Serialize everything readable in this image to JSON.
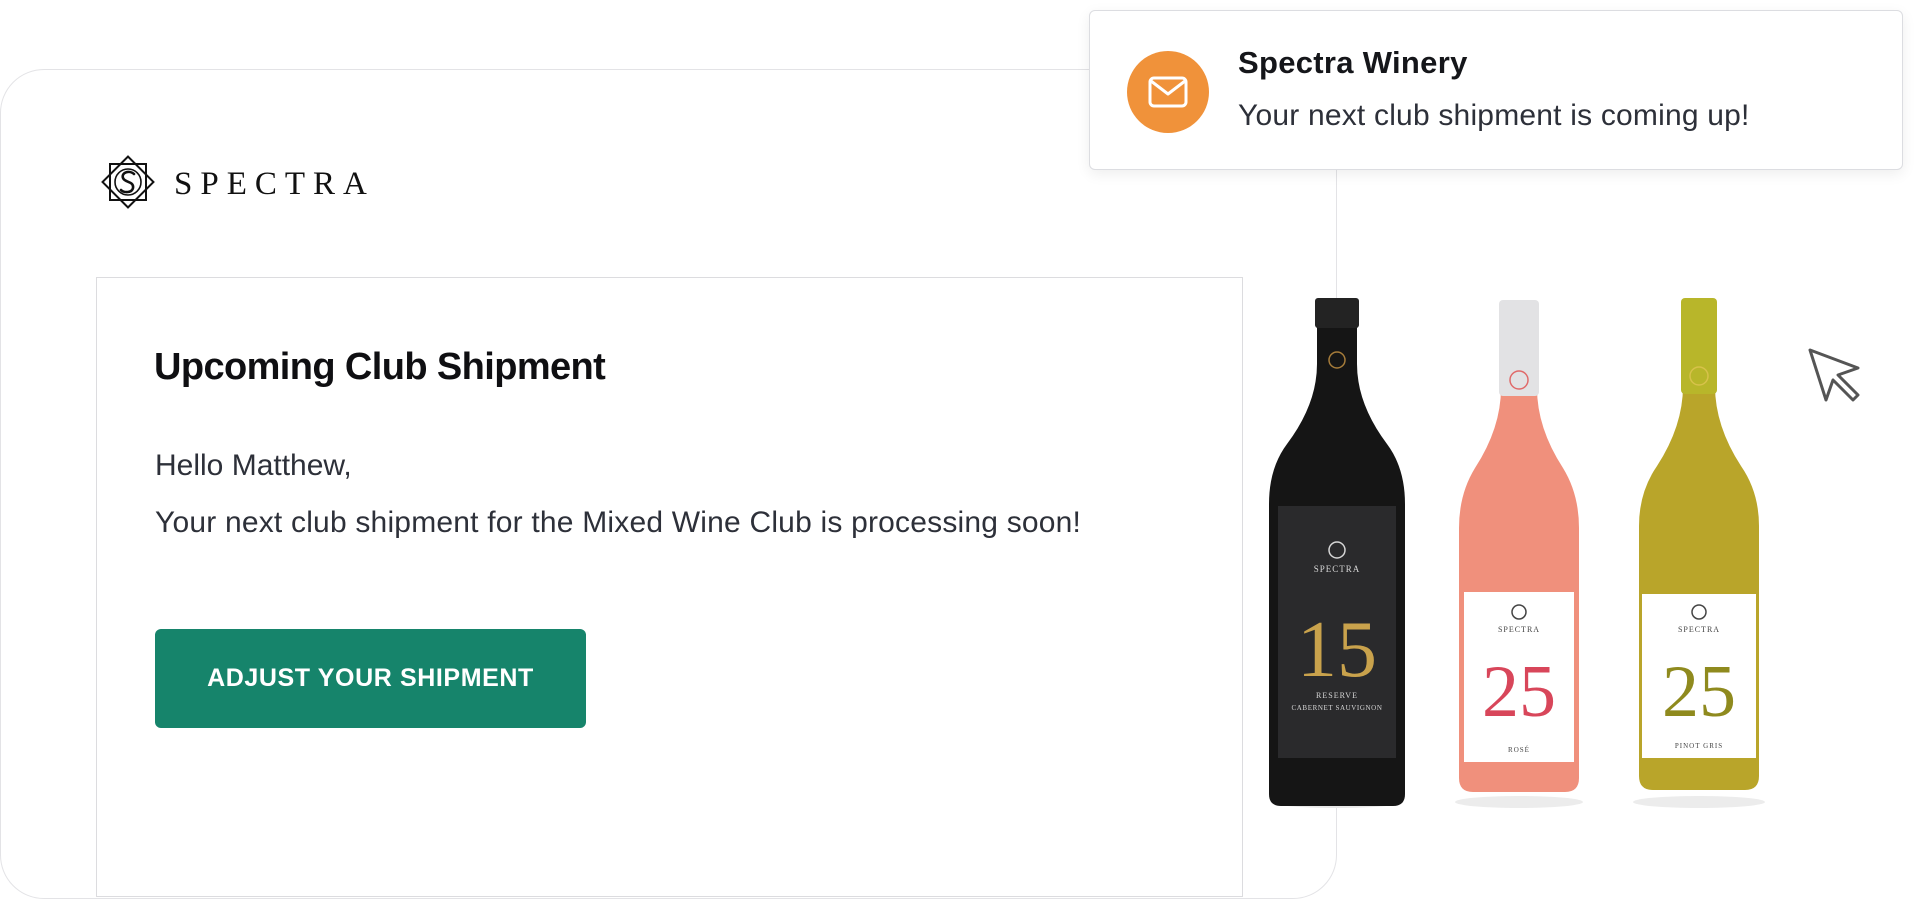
{
  "brand": {
    "logo_text": "SPECTRA",
    "logo_icon": "spectra-diamond-logo"
  },
  "email": {
    "title": "Upcoming Club Shipment",
    "greeting": "Hello Matthew,",
    "body": "Your next club shipment for the Mixed Wine Club is processing soon!",
    "cta_label": "ADJUST YOUR SHIPMENT"
  },
  "bottles": [
    {
      "brand": "SPECTRA",
      "number": "15",
      "line1": "RESERVE",
      "line2": "CABERNET SAUVIGNON",
      "glass": "#151515",
      "label": "#2a2a2c",
      "number_color": "#c9a24c"
    },
    {
      "brand": "SPECTRA",
      "number": "25",
      "line1": "ROSÉ",
      "line2": "",
      "glass": "#f0907c",
      "label": "#ffffff",
      "number_color": "#d8465a"
    },
    {
      "brand": "SPECTRA",
      "number": "25",
      "line1": "PINOT GRIS",
      "line2": "",
      "glass": "#b9a52a",
      "label": "#ffffff",
      "number_color": "#8f8a1e"
    }
  ],
  "notification": {
    "title": "Spectra Winery",
    "message": "Your next club shipment is coming up!",
    "icon": "mail-icon",
    "icon_bg": "#f0923a"
  },
  "colors": {
    "accent": "#16846b",
    "notification": "#f0923a"
  }
}
